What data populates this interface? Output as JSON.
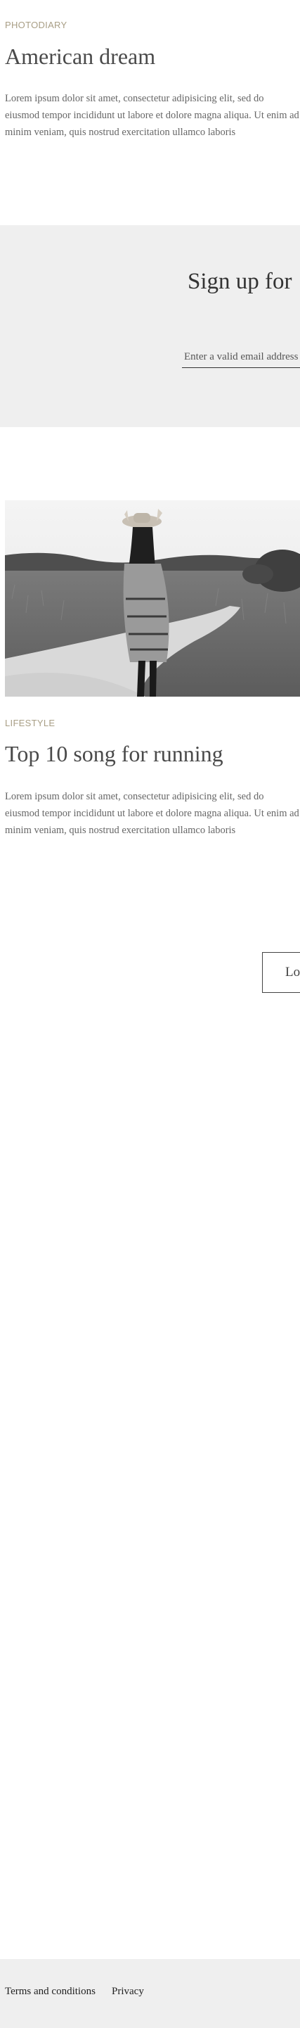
{
  "posts": [
    {
      "category": "PHOTODIARY",
      "title": "American dream",
      "excerpt": "Lorem ipsum dolor sit amet, consectetur adipisicing elit, sed do eiusmod tempor incididunt ut labore et dolore magna aliqua. Ut enim ad minim veniam, quis nostrud exercitation ullamco laboris"
    },
    {
      "category": "LIFESTYLE",
      "title": "Top 10 song for running",
      "excerpt": "Lorem ipsum dolor sit amet, consectetur adipisicing elit, sed do eiusmod tempor incididunt ut labore et dolore magna aliqua. Ut enim ad minim veniam, quis nostrud exercitation ullamco laboris"
    }
  ],
  "signup": {
    "heading": "Sign up for",
    "email_placeholder": "Enter a valid email address"
  },
  "load_more": {
    "label": "Lo"
  },
  "footer": {
    "links": [
      "Terms and conditions",
      "Privacy"
    ]
  },
  "colors": {
    "category": "#a89e85",
    "section_bg": "#efefef",
    "heading": "#4a4a4a"
  }
}
